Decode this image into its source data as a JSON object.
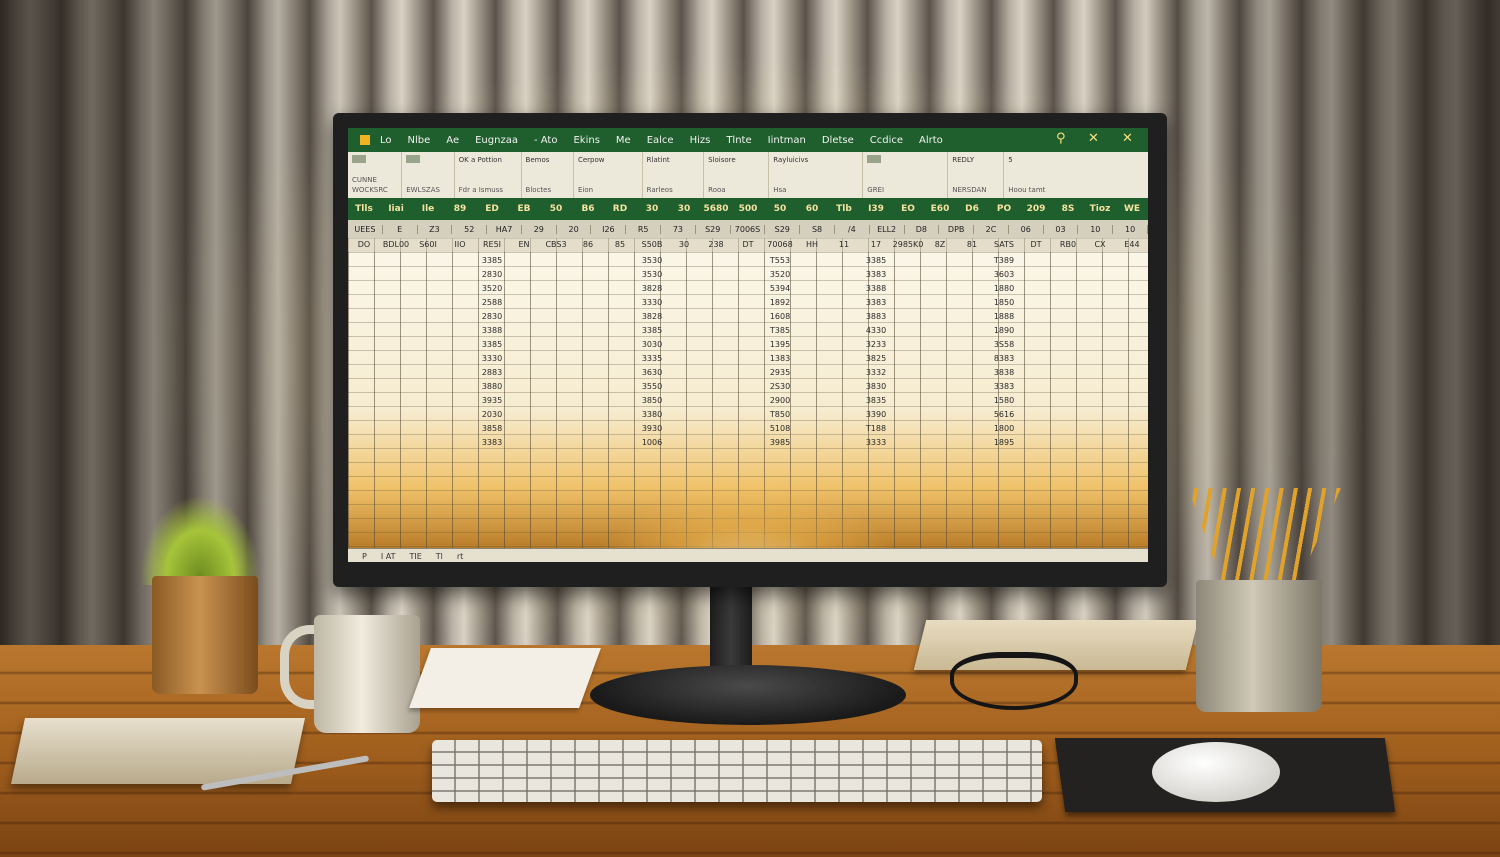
{
  "titlebar": {
    "menu": [
      "Lo",
      "Nlbe",
      "Ae",
      "Eugnzaa",
      "- Ato",
      "Ekins",
      "Me",
      "Ealce",
      "Hizs",
      "Tlnte",
      "Iintman",
      "Dletse",
      "Ccdice",
      "Alrto"
    ]
  },
  "ribbon": {
    "groups": [
      {
        "top": "",
        "bottom": "CUNNE WOCKSRC"
      },
      {
        "top": "",
        "bottom": "EWLSZAS"
      },
      {
        "top": "OK a Pottion",
        "bottom": "Fdr a Ismuss"
      },
      {
        "top": "Bemos",
        "bottom": "Bloctes"
      },
      {
        "top": "Cerpow",
        "bottom": "Eion"
      },
      {
        "top": "Rlatint",
        "bottom": "Rarleos"
      },
      {
        "top": "Sloisore",
        "bottom": "Rooa"
      },
      {
        "top": "Rayluicivs",
        "bottom": "Hsa"
      },
      {
        "top": "",
        "bottom": "GREI"
      },
      {
        "top": "REDLY",
        "bottom": "NERSDAN"
      },
      {
        "top": "5",
        "bottom": "Hoou tamt"
      }
    ]
  },
  "header_cells": [
    "Tlls",
    "Iiai",
    "Ile",
    "89",
    "ED",
    "EB",
    "50",
    "B6",
    "RD",
    "30",
    "30",
    "5680",
    "500",
    "50",
    "60",
    "Tlb",
    "I39",
    "EO",
    "E60",
    "D6",
    "PO",
    "209",
    "8S",
    "Tioz",
    "WE"
  ],
  "sub_cells": [
    "UEES",
    "E",
    "Z3",
    "52",
    "HA7",
    "29",
    "20",
    "I26",
    "R5",
    "73",
    "S29",
    "7006S",
    "S29",
    "S8",
    "/4",
    "ELL2",
    "D8",
    "DPB",
    "2C",
    "06",
    "03",
    "10",
    "10"
  ],
  "row1_cells": [
    "DO",
    "BDL00",
    "S60I",
    "IIO",
    "RE5I",
    "EN",
    "CBS3",
    "86",
    "85",
    "S50B",
    "30",
    "238",
    "DT",
    "70068",
    "HH",
    "11",
    "17",
    "2985K0",
    "8Z",
    "81",
    "SATS",
    "DT",
    "RB0",
    "CX",
    "E44"
  ],
  "data_rows": [
    [
      "3385",
      "3530",
      "T553",
      "3385",
      "T389"
    ],
    [
      "2830",
      "3530",
      "3520",
      "3383",
      "3603"
    ],
    [
      "3520",
      "3828",
      "5394",
      "3388",
      "1880"
    ],
    [
      "2588",
      "3330",
      "1892",
      "3383",
      "1850"
    ],
    [
      "2830",
      "3828",
      "1608",
      "3883",
      "1888"
    ],
    [
      "3388",
      "3385",
      "T385",
      "4330",
      "1890"
    ],
    [
      "3385",
      "3030",
      "1395",
      "3233",
      "3S58"
    ],
    [
      "3330",
      "3335",
      "1383",
      "3825",
      "8383"
    ],
    [
      "2883",
      "3630",
      "2935",
      "3332",
      "3838"
    ],
    [
      "3880",
      "3550",
      "2S30",
      "3830",
      "3383"
    ],
    [
      "3935",
      "3850",
      "2900",
      "3835",
      "1580"
    ],
    [
      "2030",
      "3380",
      "T850",
      "3390",
      "5616"
    ],
    [
      "3858",
      "3930",
      "5108",
      "T188",
      "1800"
    ],
    [
      "3383",
      "1006",
      "3985",
      "3333",
      "1895"
    ]
  ],
  "status_text": [
    "P",
    "I AT",
    "TIE",
    "Tl",
    "rt"
  ],
  "colors": {
    "excel_green": "#1f5f2d",
    "header_text": "#f4e2a0",
    "desk": "#a4621f"
  }
}
